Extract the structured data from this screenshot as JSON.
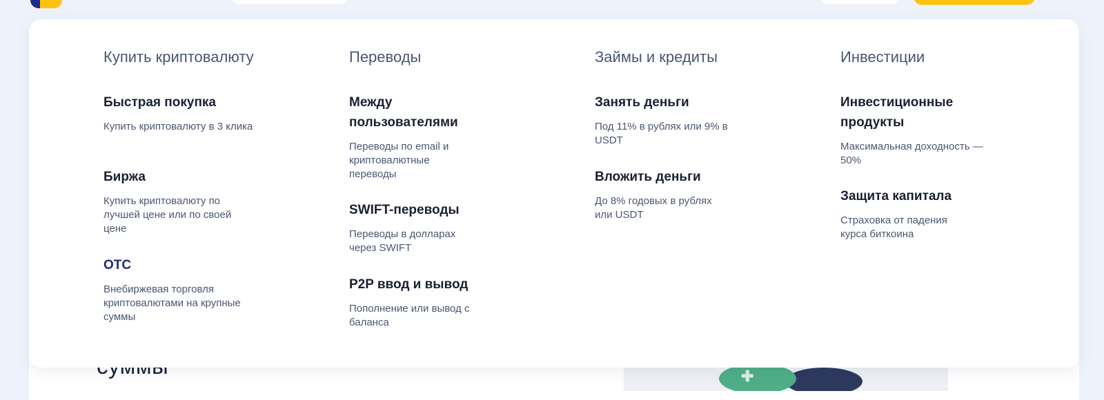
{
  "background": {
    "section_heading": "суммы"
  },
  "menu": {
    "columns": [
      {
        "title": "Купить криптовалюту",
        "items": [
          {
            "title": "Быстрая покупка",
            "desc": "Купить криптовалюту в 3 клика"
          },
          {
            "title": "Биржа",
            "desc": "Купить криптовалюту по лучшей цене или по своей цене"
          },
          {
            "title": "OTC",
            "desc": "Внебиржевая торговля криптовалютами на крупные суммы"
          }
        ]
      },
      {
        "title": "Переводы",
        "items": [
          {
            "title": "Между пользователями",
            "desc": "Переводы по email и криптовалютные переводы"
          },
          {
            "title": "SWIFT-переводы",
            "desc": "Переводы в долларах через SWIFT"
          },
          {
            "title": "P2P ввод и вывод",
            "desc": "Пополнение или вывод с баланса"
          }
        ]
      },
      {
        "title": "Займы и кредиты",
        "items": [
          {
            "title": "Занять деньги",
            "desc": "Под 11% в рублях или 9% в USDT"
          },
          {
            "title": "Вложить деньги",
            "desc": "До 8% годовых в рублях или USDT"
          }
        ]
      },
      {
        "title": "Инвестиции",
        "items": [
          {
            "title": "Инвестиционные продукты",
            "desc": "Максимальная доходность — 50%"
          },
          {
            "title": "Защита капитала",
            "desc": "Страховка от падения курса биткоина"
          }
        ]
      }
    ]
  }
}
